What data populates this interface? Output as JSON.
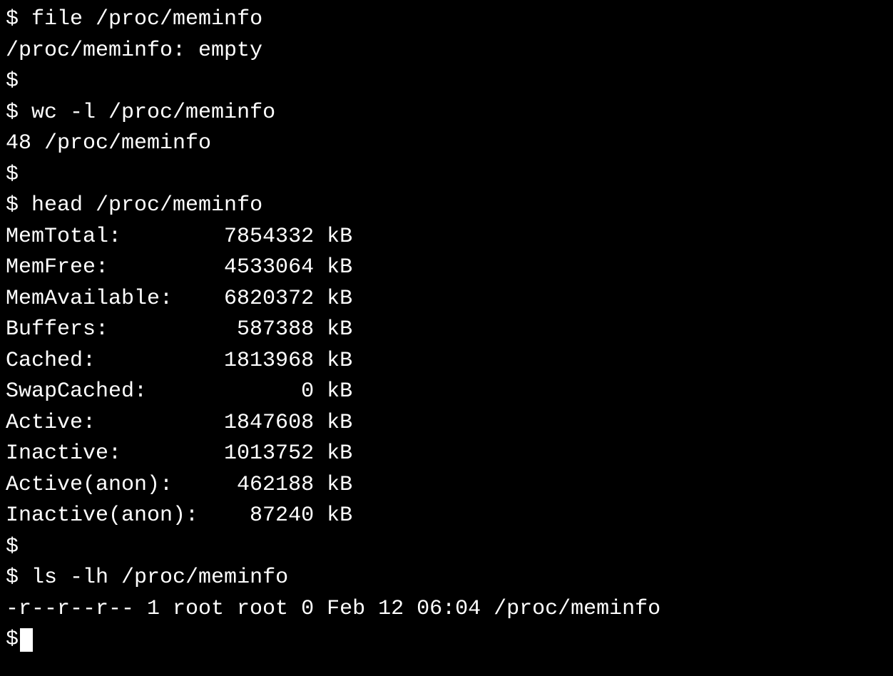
{
  "prompt": "$ ",
  "lines": [
    {
      "type": "cmd",
      "text": "file /proc/meminfo"
    },
    {
      "type": "output",
      "text": "/proc/meminfo: empty"
    },
    {
      "type": "prompt",
      "text": ""
    },
    {
      "type": "cmd",
      "text": "wc -l /proc/meminfo"
    },
    {
      "type": "output",
      "text": "48 /proc/meminfo"
    },
    {
      "type": "prompt",
      "text": ""
    },
    {
      "type": "cmd",
      "text": "head /proc/meminfo"
    },
    {
      "type": "output",
      "text": "MemTotal:        7854332 kB"
    },
    {
      "type": "output",
      "text": "MemFree:         4533064 kB"
    },
    {
      "type": "output",
      "text": "MemAvailable:    6820372 kB"
    },
    {
      "type": "output",
      "text": "Buffers:          587388 kB"
    },
    {
      "type": "output",
      "text": "Cached:          1813968 kB"
    },
    {
      "type": "output",
      "text": "SwapCached:            0 kB"
    },
    {
      "type": "output",
      "text": "Active:          1847608 kB"
    },
    {
      "type": "output",
      "text": "Inactive:        1013752 kB"
    },
    {
      "type": "output",
      "text": "Active(anon):     462188 kB"
    },
    {
      "type": "output",
      "text": "Inactive(anon):    87240 kB"
    },
    {
      "type": "prompt",
      "text": ""
    },
    {
      "type": "cmd",
      "text": "ls -lh /proc/meminfo"
    },
    {
      "type": "output",
      "text": "-r--r--r-- 1 root root 0 Feb 12 06:04 /proc/meminfo"
    },
    {
      "type": "prompt-cursor",
      "text": ""
    }
  ]
}
